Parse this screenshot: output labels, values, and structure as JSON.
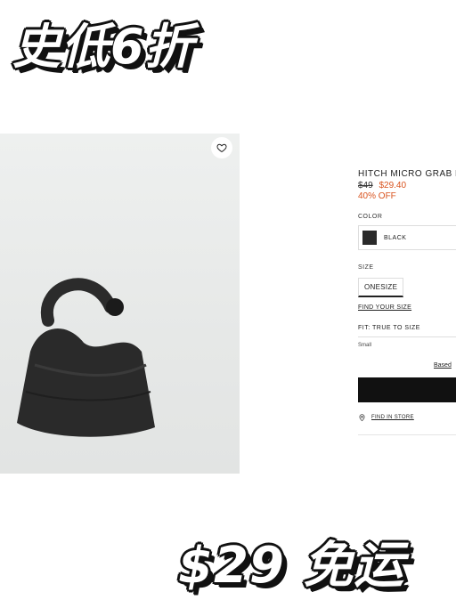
{
  "promo": {
    "top": "史低6折",
    "bottom": "$29 免运"
  },
  "product": {
    "title": "HITCH MICRO GRAB B",
    "old_price": "$49",
    "new_price": "$29.40",
    "discount": "40% OFF",
    "color_label": "COLOR",
    "color_name": "BLACK",
    "size_label": "SIZE",
    "size_option": "ONESIZE",
    "find_size": "FIND YOUR SIZE",
    "fit": "FIT: TRUE TO SIZE",
    "fit_scale_left": "Small",
    "based_on": "Based",
    "find_in_store": "FIND IN STORE"
  },
  "colors": {
    "sale": "#d9531e",
    "swatch": "#2a2a2a",
    "add_button": "#111111"
  },
  "icons": {
    "wishlist": "heart-icon",
    "store": "location-pin-icon"
  }
}
